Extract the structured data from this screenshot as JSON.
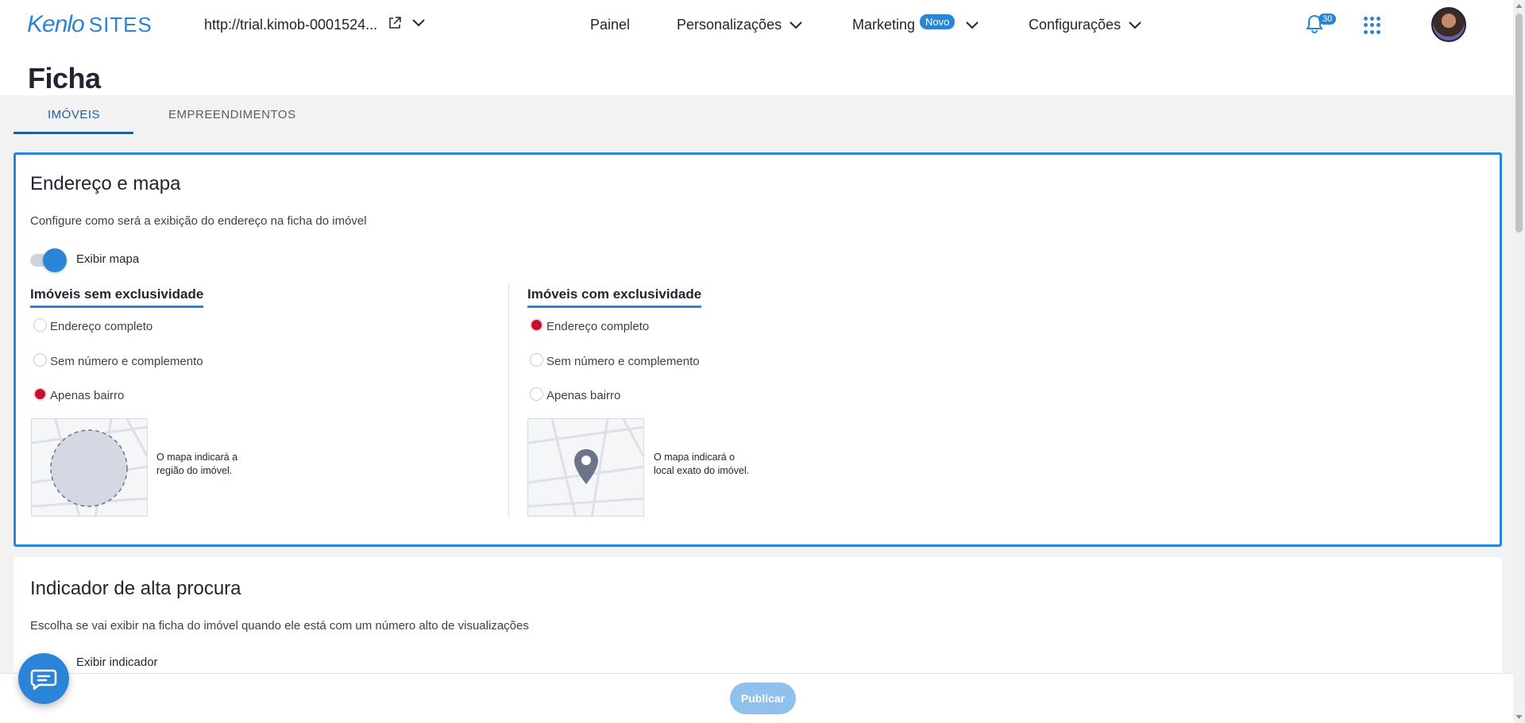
{
  "header": {
    "logo_brand": "Kenlo",
    "logo_suffix": "SITES",
    "site_url": "http://trial.kimob-0001524...",
    "nav": {
      "painel": "Painel",
      "personalizacoes": "Personalizações",
      "marketing": "Marketing",
      "marketing_badge": "Novo",
      "configuracoes": "Configurações"
    },
    "notification_count": "30"
  },
  "page": {
    "title": "Ficha",
    "tabs": [
      {
        "label": "IMÓVEIS",
        "active": true
      },
      {
        "label": "EMPREENDIMENTOS",
        "active": false
      }
    ]
  },
  "address_card": {
    "title": "Endereço e mapa",
    "description": "Configure como será a exibição do endereço na ficha do imóvel",
    "toggle_label": "Exibir mapa",
    "toggle_on": true,
    "left": {
      "heading": "Imóveis sem exclusividade",
      "options": [
        "Endereço completo",
        "Sem número e complemento",
        "Apenas bairro"
      ],
      "selected": "Apenas bairro",
      "caption": [
        "O mapa indicará a",
        "região do imóvel."
      ]
    },
    "right": {
      "heading": "Imóveis com exclusividade",
      "options": [
        "Endereço completo",
        "Sem número e complemento",
        "Apenas bairro"
      ],
      "selected": "Endereço completo",
      "caption": [
        "O mapa indicará o",
        "local exato do imóvel."
      ]
    }
  },
  "indicator_card": {
    "title": "Indicador de alta procura",
    "description": "Escolha se vai exibir na ficha do imóvel quando ele está com um número alto de visualizações",
    "toggle_label": "Exibir indicador"
  },
  "footer": {
    "publish_label": "Publicar"
  },
  "colors": {
    "accent": "#2a85d6",
    "radio_selected": "#c8102e",
    "tab_active": "#1d5fa0",
    "publish_disabled": "#8fc1ec"
  },
  "icons": [
    "external-link-icon",
    "chevron-down-icon",
    "bell-icon",
    "apps-grid-icon",
    "map-pin-icon",
    "chat-icon"
  ]
}
